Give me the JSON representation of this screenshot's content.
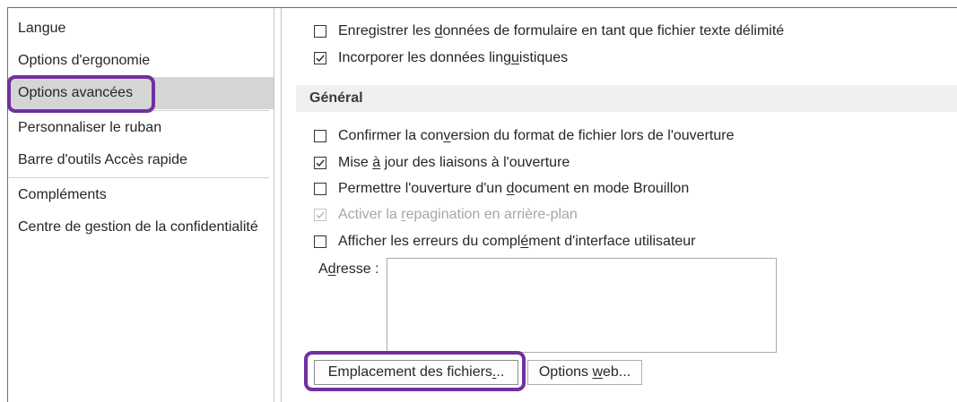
{
  "sidebar": {
    "items": [
      {
        "label": "Langue"
      },
      {
        "label": "Options d'ergonomie"
      },
      {
        "label": "Options avancées",
        "selected": true
      },
      {
        "label": "Personnaliser le ruban"
      },
      {
        "label": "Barre d'outils Accès rapide"
      },
      {
        "label": "Compléments"
      },
      {
        "label": "Centre de gestion de la confidentialité"
      }
    ]
  },
  "options_top": [
    {
      "label": "Enregistrer les données de formulaire en tant que fichier texte délimité",
      "key_index": 16,
      "checked": false,
      "enabled": true
    },
    {
      "label": "Incorporer les données linguistiques",
      "key_index": 27,
      "checked": true,
      "enabled": true
    }
  ],
  "general": {
    "title": "Général",
    "options": [
      {
        "label": "Confirmer la conversion du format de fichier lors de l'ouverture",
        "key_index": 16,
        "checked": false,
        "enabled": true
      },
      {
        "label": "Mise à jour des liaisons à l'ouverture",
        "key_index": 5,
        "checked": true,
        "enabled": true
      },
      {
        "label": "Permettre l'ouverture d'un document en mode Brouillon",
        "key_index": 27,
        "checked": false,
        "enabled": true
      },
      {
        "label": "Activer la repagination en arrière-plan",
        "key_index": 11,
        "checked": true,
        "enabled": false
      },
      {
        "label": "Afficher les erreurs du complément d'interface utilisateur",
        "key_index": 29,
        "checked": false,
        "enabled": true
      }
    ],
    "address": {
      "label": "Adresse :",
      "key_index": 1
    },
    "buttons": {
      "file_locations": {
        "label": "Emplacement des fichiers...",
        "key_index": 24
      },
      "web_options": {
        "label": "Options web...",
        "key_index": 8
      }
    }
  },
  "colors": {
    "highlight": "#7030a0",
    "selected_bg": "#d5d5d5",
    "section_bg": "#f0f0f0",
    "disabled_text": "#a6a6a6"
  },
  "icons": {
    "checkbox_mark": "checkmark-icon"
  }
}
